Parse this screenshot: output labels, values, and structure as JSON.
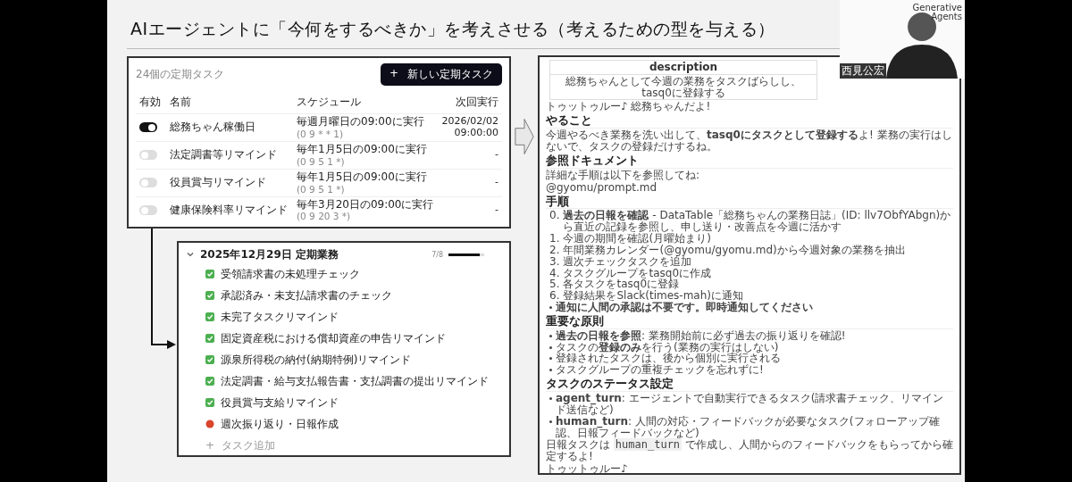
{
  "slide": {
    "title": "AIエージェントに「今何をするべきか」を考えさせる（考えるための型を与える）"
  },
  "schedule": {
    "count": "24個の定期タスク",
    "add_button": {
      "icon": "+",
      "label": "新しい定期タスク"
    },
    "columns": [
      "有効",
      "名前",
      "スケジュール",
      "次回実行"
    ],
    "rows": [
      {
        "on": true,
        "name": "総務ちゃん稼働日",
        "schedule": "毎週月曜日の09:00に実行",
        "cron": "(0 9 * * 1)",
        "next": "2026/02/02 09:00:00"
      },
      {
        "on": false,
        "name": "法定調書等リマインド",
        "schedule": "毎年1月5日の09:00に実行",
        "cron": "(0 9 5 1 *)",
        "next": "-"
      },
      {
        "on": false,
        "name": "役員賞与リマインド",
        "schedule": "毎年1月5日の09:00に実行",
        "cron": "(0 9 5 1 *)",
        "next": "-"
      },
      {
        "on": false,
        "name": "健康保険料率リマインド",
        "schedule": "毎年3月20日の09:00に実行",
        "cron": "(0 9 20 3 *)",
        "next": "-"
      }
    ]
  },
  "task_group": {
    "title": "2025年12月29日 定期業務",
    "expanded": true,
    "progress": "7/8",
    "level": 0.875,
    "tasks": [
      {
        "label": "受領請求書の未処理チェック",
        "done": true
      },
      {
        "label": "承認済み・未支払請求書のチェック",
        "done": true
      },
      {
        "label": "未完了タスクリマインド",
        "done": true
      },
      {
        "label": "固定資産税における償却資産の申告リマインド",
        "done": true
      },
      {
        "label": "源泉所得税の納付(納期特例)リマインド",
        "done": true
      },
      {
        "label": "法定調書・給与支払報告書・支払調書の提出リマインド",
        "done": true
      },
      {
        "label": "役員賞与支給リマインド",
        "done": true
      },
      {
        "label": "週次振り返り・日報作成",
        "done": false
      }
    ],
    "add": {
      "icon": "+",
      "label": "タスク追加"
    }
  },
  "document": {
    "table": {
      "header": "description",
      "cell": "総務ちゃんとして今週の業務をタスクばらしし、tasq0に登録する"
    },
    "blocks": [
      {
        "kind": "para",
        "text": "トゥットゥルー♪ 総務ちゃんだよ!"
      },
      {
        "kind": "heading",
        "text": "やること"
      },
      {
        "kind": "para",
        "text": "今週やるべき業務を洗い出して、**tasq0にタスクとして登録する**よ! 業務の実行はしないで、タスクの登録だけするね。"
      },
      {
        "kind": "heading",
        "text": "参照ドキュメント"
      },
      {
        "kind": "para",
        "text": "詳細な手順は以下を参照してね:"
      },
      {
        "kind": "para",
        "text": "@gyomu/prompt.md"
      },
      {
        "kind": "heading",
        "text": "手順"
      },
      {
        "kind": "numbered",
        "items": [
          {
            "num": "0.",
            "text": "**過去の日報を確認** - DataTable「総務ちゃんの業務日誌」(ID: llv7ObfYAbgn)から直近の記録を参照し、申し送り・改善点を今週に活かす"
          },
          {
            "num": "1.",
            "text": "今週の期間を確認(月曜始まり)"
          },
          {
            "num": "2.",
            "text": "年間業務カレンダー(@gyomu/gyomu.md)から今週対象の業務を抽出"
          },
          {
            "num": "3.",
            "text": "週次チェックタスクを追加"
          },
          {
            "num": "4.",
            "text": "タスクグループをtasq0に作成"
          },
          {
            "num": "5.",
            "text": "各タスクをtasq0に登録"
          },
          {
            "num": "6.",
            "text": "登録結果をSlack(times-mah)に通知"
          }
        ]
      },
      {
        "kind": "note",
        "text": "通知に人間の承認は不要です。即時通知してください"
      },
      {
        "kind": "heading",
        "text": "重要な原則"
      },
      {
        "kind": "bullets",
        "items": [
          "**過去の日報を参照**: 業務開始前に必ず過去の振り返りを確認!",
          "タスクの**登録のみ**を行う(業務の実行はしない)",
          "登録されたタスクは、後から個別に実行される",
          "タスクグループの重複チェックを忘れずに!"
        ]
      },
      {
        "kind": "heading",
        "text": "タスクのステータス設定"
      },
      {
        "kind": "bullets",
        "items": [
          "**agent_turn**: エージェントで自動実行できるタスク(請求書チェック、リマインド送信など)",
          "**human_turn**: 人間の対応・フィードバックが必要なタスク(フォローアップ確認、日報フィードバックなど)"
        ]
      },
      {
        "kind": "segments",
        "parts": [
          {
            "kind": "text",
            "text": "日報タスクは "
          },
          {
            "kind": "code",
            "text": "human_turn"
          },
          {
            "kind": "text",
            "text": " で作成し、人間からのフィードバックをもらってから確定するよ!"
          }
        ]
      },
      {
        "kind": "para",
        "text": "トゥットゥルー♪"
      }
    ]
  },
  "video": {
    "logo": [
      "Generative",
      "Agents"
    ],
    "name": "西見公宏"
  }
}
